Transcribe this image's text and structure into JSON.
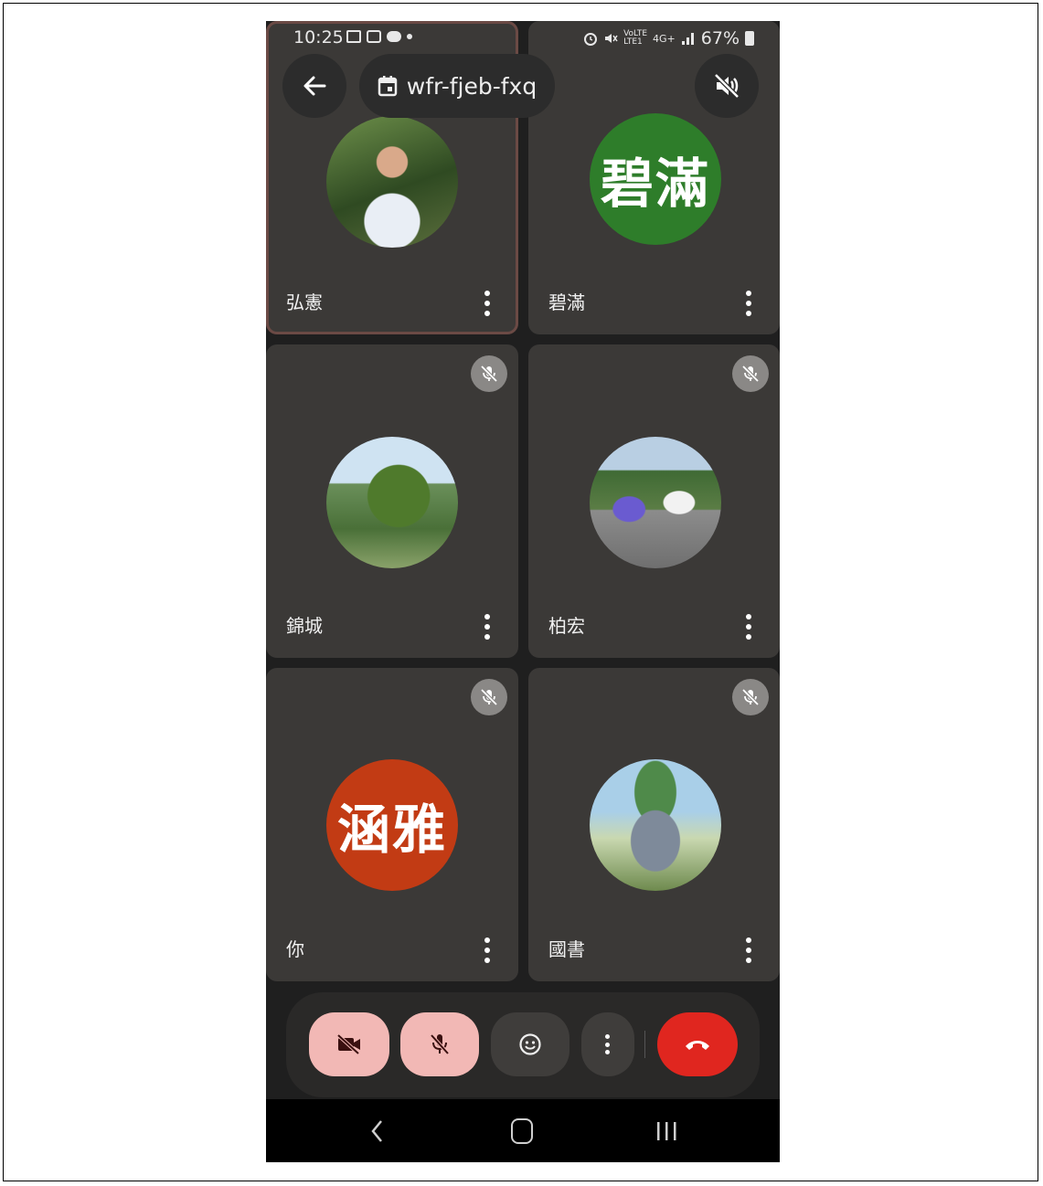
{
  "status_bar": {
    "time": "10:25",
    "battery": "67%",
    "network": "4G+",
    "volte": "VoLTE",
    "lte": "LTE1"
  },
  "header": {
    "meeting_code": "wfr-fjeb-fxq",
    "back_icon": "arrow-left-icon",
    "calendar_icon": "calendar-icon",
    "speaker_icon": "speaker-muted-icon"
  },
  "participants": [
    {
      "name": "弘憲",
      "avatar_type": "photo",
      "muted": false,
      "active_speaker": true
    },
    {
      "name": "碧滿",
      "avatar_type": "initials",
      "initials": "碧滿",
      "avatar_color": "#2e7d2a",
      "muted": false
    },
    {
      "name": "錦城",
      "avatar_type": "photo",
      "muted": true
    },
    {
      "name": "柏宏",
      "avatar_type": "photo",
      "muted": true
    },
    {
      "name": "你",
      "avatar_type": "initials",
      "initials": "涵雅",
      "avatar_color": "#c23b14",
      "muted": true
    },
    {
      "name": "國書",
      "avatar_type": "photo",
      "muted": true
    }
  ],
  "controls": {
    "camera": "camera-off-icon",
    "mic": "mic-off-icon",
    "reactions": "emoji-icon",
    "more": "more-vert-icon",
    "end_call": "hang-up-icon",
    "colors": {
      "off_button": "#f2b8b5",
      "end_call": "#e0261f"
    }
  },
  "nav": {
    "back": "back-chevron-icon",
    "home": "home-icon",
    "recents": "recents-icon"
  }
}
